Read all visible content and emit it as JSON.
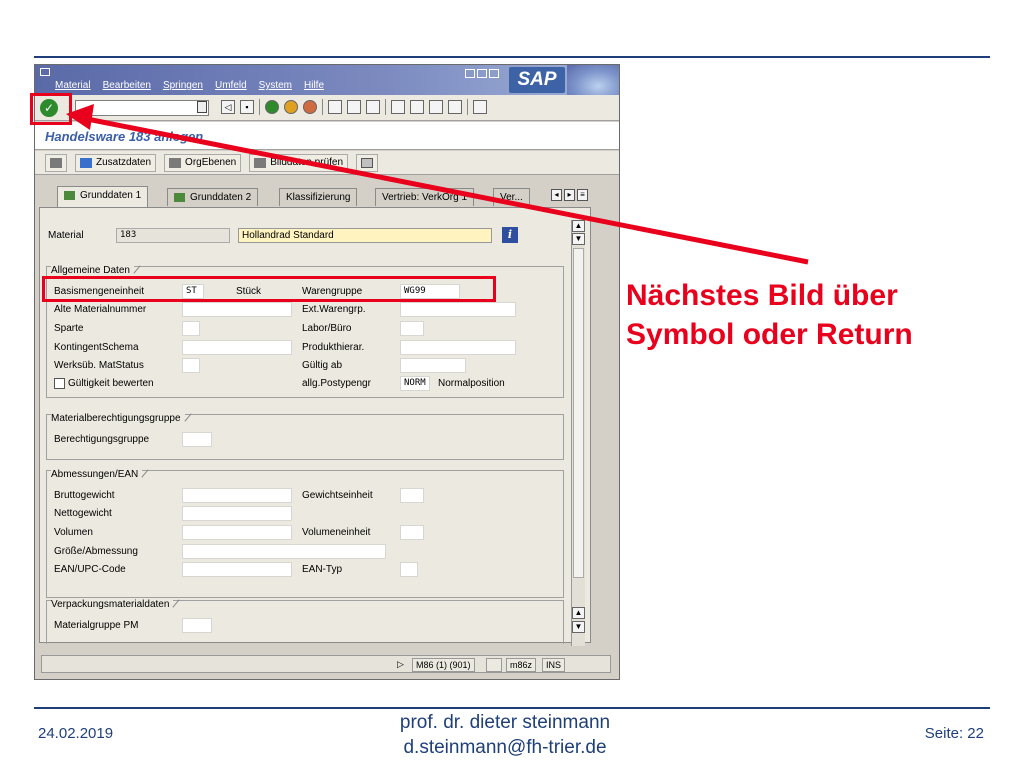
{
  "slide": {
    "callout_line1": "Nächstes Bild über",
    "callout_line2": "Symbol oder Return",
    "date": "24.02.2019",
    "author_line1": "prof. dr. dieter steinmann",
    "author_line2": "d.steinmann@fh-trier.de",
    "page": "Seite: 22",
    "accent_color": "#e8001c"
  },
  "sap": {
    "logo": "SAP",
    "menu": [
      "Material",
      "Bearbeiten",
      "Springen",
      "Umfeld",
      "System",
      "Hilfe"
    ],
    "screen_title": "Handelsware 183 anlegen",
    "app_toolbar": [
      "Zusatzdaten",
      "OrgEbenen",
      "Bilddaten prüfen"
    ],
    "tabs": [
      "Grunddaten 1",
      "Grunddaten 2",
      "Klassifizierung",
      "Vertrieb: VerkOrg 1",
      "Ver..."
    ],
    "material": {
      "label": "Material",
      "number": "183",
      "description": "Hollandrad Standard"
    },
    "allgemeine": {
      "title": "Allgemeine Daten",
      "basismenge_label": "Basismengeneinheit",
      "basismenge_value": "ST",
      "basismenge_text": "Stück",
      "warengruppe_label": "Warengruppe",
      "warengruppe_value": "WG99",
      "alte_label": "Alte Materialnummer",
      "extwg_label": "Ext.Warengrp.",
      "sparte_label": "Sparte",
      "labor_label": "Labor/Büro",
      "kontingent_label": "KontingentSchema",
      "produkthier_label": "Produkthierar.",
      "werksueb_label": "Werksüb. MatStatus",
      "gueltig_label": "Gültig ab",
      "gueltigkeit_label": "Gültigkeit bewerten",
      "postyp_label": "allg.Postypengr",
      "postyp_value": "NORM",
      "postyp_text": "Normalposition"
    },
    "berechtigung": {
      "title": "Materialberechtigungsgruppe",
      "label": "Berechtigungsgruppe"
    },
    "abmessungen": {
      "title": "Abmessungen/EAN",
      "brutto": "Bruttogewicht",
      "gewichtseinheit": "Gewichtseinheit",
      "netto": "Nettogewicht",
      "volumen": "Volumen",
      "volumeneinheit": "Volumeneinheit",
      "groesse": "Größe/Abmessung",
      "ean": "EAN/UPC-Code",
      "eantyp": "EAN-Typ"
    },
    "verpackung": {
      "title": "Verpackungsmaterialdaten",
      "label": "Materialgruppe PM"
    },
    "status": {
      "system": "M86 (1) (901)",
      "client": "m86z",
      "mode": "INS"
    }
  }
}
